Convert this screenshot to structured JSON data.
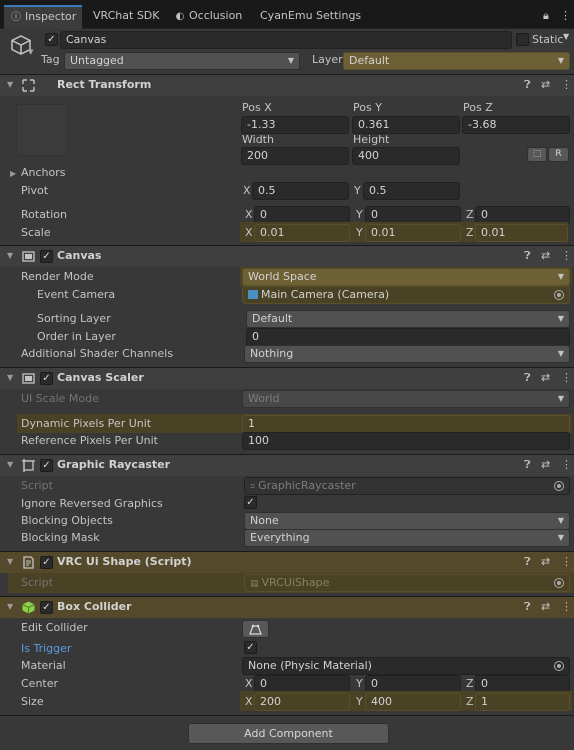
{
  "tabs": [
    {
      "label": "Inspector",
      "icon": "info-icon"
    },
    {
      "label": "VRChat SDK"
    },
    {
      "label": "Occlusion",
      "icon": "occlusion-icon"
    },
    {
      "label": "CyanEmu Settings"
    }
  ],
  "header": {
    "name": "Canvas",
    "static_label": "Static",
    "tag_label": "Tag",
    "tag_value": "Untagged",
    "layer_label": "Layer",
    "layer_value": "Default"
  },
  "rect_transform": {
    "title": "Rect Transform",
    "pos_x_label": "Pos X",
    "pos_y_label": "Pos Y",
    "pos_z_label": "Pos Z",
    "pos_x": "-1.33",
    "pos_y": "0.361",
    "pos_z": "-3.68",
    "width_label": "Width",
    "height_label": "Height",
    "width": "200",
    "height": "400",
    "r_button": "R",
    "anchors_label": "Anchors",
    "pivot_label": "Pivot",
    "pivot_x": "0.5",
    "pivot_y": "0.5",
    "rotation_label": "Rotation",
    "rot_x": "0",
    "rot_y": "0",
    "rot_z": "0",
    "scale_label": "Scale",
    "scale_x": "0.01",
    "scale_y": "0.01",
    "scale_z": "0.01",
    "x": "X",
    "y": "Y",
    "z": "Z"
  },
  "canvas": {
    "title": "Canvas",
    "render_mode_label": "Render Mode",
    "render_mode": "World Space",
    "event_camera_label": "Event Camera",
    "event_camera": "Main Camera (Camera)",
    "sorting_layer_label": "Sorting Layer",
    "sorting_layer": "Default",
    "order_label": "Order in Layer",
    "order": "0",
    "shader_label": "Additional Shader Channels",
    "shader": "Nothing"
  },
  "canvas_scaler": {
    "title": "Canvas Scaler",
    "ui_scale_label": "UI Scale Mode",
    "ui_scale": "World",
    "dynamic_label": "Dynamic Pixels Per Unit",
    "dynamic": "1",
    "reference_label": "Reference Pixels Per Unit",
    "reference": "100"
  },
  "raycaster": {
    "title": "Graphic Raycaster",
    "script_label": "Script",
    "script": "GraphicRaycaster",
    "ignore_label": "Ignore Reversed Graphics",
    "blocking_objects_label": "Blocking Objects",
    "blocking_objects": "None",
    "blocking_mask_label": "Blocking Mask",
    "blocking_mask": "Everything"
  },
  "vrc_shape": {
    "title": "VRC Ui Shape (Script)",
    "script_label": "Script",
    "script": "VRCUiShape"
  },
  "box_collider": {
    "title": "Box Collider",
    "edit_label": "Edit Collider",
    "trigger_label": "Is Trigger",
    "material_label": "Material",
    "material": "None (Physic Material)",
    "center_label": "Center",
    "center_x": "0",
    "center_y": "0",
    "center_z": "0",
    "size_label": "Size",
    "size_x": "200",
    "size_y": "400",
    "size_z": "1"
  },
  "add_component": "Add Component",
  "colors": {
    "accent": "#3a79bb",
    "override": "#4a4225",
    "override_header": "#54492a"
  }
}
